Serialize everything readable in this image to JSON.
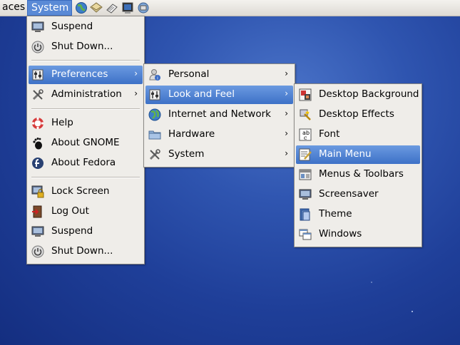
{
  "panel": {
    "places_label": "aces",
    "system_label": "System",
    "launchers": [
      "web-browser-icon",
      "mail-icon",
      "note-editor-icon",
      "terminal-icon",
      "remote-icon"
    ]
  },
  "system_menu": {
    "items": [
      {
        "label": "Suspend",
        "icon": "monitor-icon"
      },
      {
        "label": "Shut Down...",
        "icon": "power-icon"
      },
      {
        "label": "Preferences",
        "icon": "preferences-icon",
        "arrow": "›"
      },
      {
        "label": "Administration",
        "icon": "tools-icon",
        "arrow": "›"
      },
      {
        "label": "Help",
        "icon": "help-icon"
      },
      {
        "label": "About GNOME",
        "icon": "gnome-foot-icon"
      },
      {
        "label": "About Fedora",
        "icon": "fedora-icon"
      },
      {
        "label": "Lock Screen",
        "icon": "lock-icon"
      },
      {
        "label": "Log Out",
        "icon": "logout-icon"
      },
      {
        "label": "Suspend",
        "icon": "monitor-icon"
      },
      {
        "label": "Shut Down...",
        "icon": "power-icon"
      }
    ]
  },
  "preferences_menu": {
    "items": [
      {
        "label": "Personal",
        "icon": "personal-icon",
        "arrow": "›"
      },
      {
        "label": "Look and Feel",
        "icon": "preferences-icon",
        "arrow": "›"
      },
      {
        "label": "Internet and Network",
        "icon": "globe-icon",
        "arrow": "›"
      },
      {
        "label": "Hardware",
        "icon": "folder-icon",
        "arrow": "›"
      },
      {
        "label": "System",
        "icon": "tools-icon",
        "arrow": "›"
      }
    ]
  },
  "look_feel_menu": {
    "items": [
      {
        "label": "Desktop Background",
        "icon": "wallpaper-icon"
      },
      {
        "label": "Desktop Effects",
        "icon": "effects-icon"
      },
      {
        "label": "Font",
        "icon": "font-icon"
      },
      {
        "label": "Main Menu",
        "icon": "main-menu-icon"
      },
      {
        "label": "Menus & Toolbars",
        "icon": "toolbars-icon"
      },
      {
        "label": "Screensaver",
        "icon": "monitor-icon"
      },
      {
        "label": "Theme",
        "icon": "theme-icon"
      },
      {
        "label": "Windows",
        "icon": "windows-icon"
      }
    ]
  },
  "colors": {
    "selection": "#3d71c7",
    "panel_active": "#5a8ad6",
    "desktop": "#1f3f99"
  }
}
